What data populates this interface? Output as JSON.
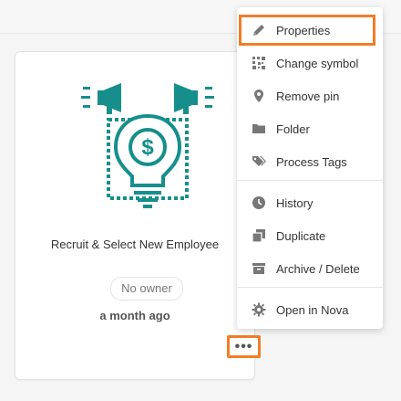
{
  "card": {
    "title": "Recruit & Select New Employee",
    "owner": "No owner",
    "time": "a month ago",
    "more_label": "•••",
    "icon": "lightbulb-money-megaphone-icon",
    "accent_color": "#168f8c"
  },
  "menu": {
    "items": [
      {
        "label": "Properties",
        "icon": "pencil-icon"
      },
      {
        "label": "Change symbol",
        "icon": "change-symbol-icon"
      },
      {
        "label": "Remove pin",
        "icon": "pin-icon"
      },
      {
        "label": "Folder",
        "icon": "folder-icon"
      },
      {
        "label": "Process Tags",
        "icon": "tags-icon"
      },
      {
        "label": "History",
        "icon": "clock-icon"
      },
      {
        "label": "Duplicate",
        "icon": "duplicate-icon"
      },
      {
        "label": "Archive / Delete",
        "icon": "archive-icon"
      },
      {
        "label": "Open in Nova",
        "icon": "gear-icon"
      }
    ]
  },
  "highlight_color": "#f27d26"
}
